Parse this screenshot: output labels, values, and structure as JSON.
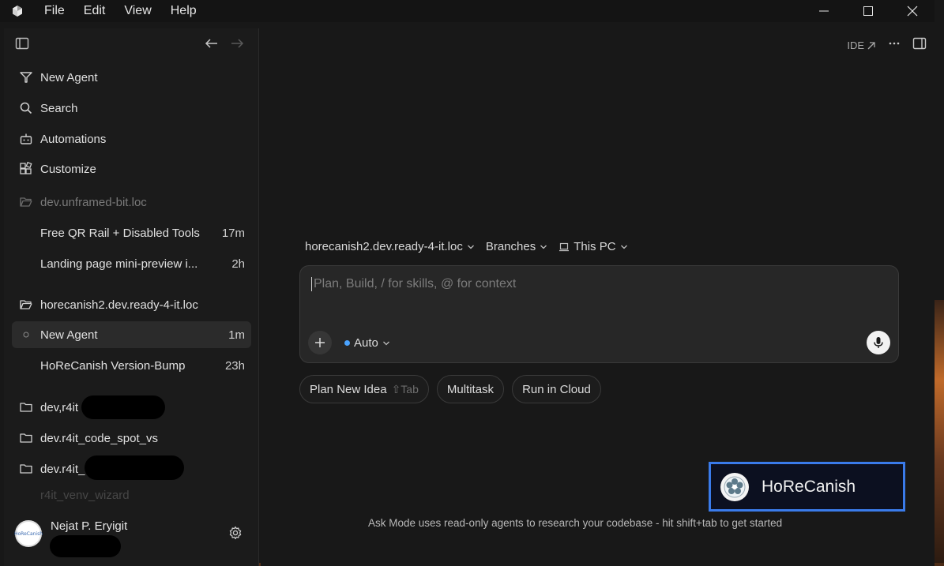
{
  "titlebar": {
    "menu": [
      "File",
      "Edit",
      "View",
      "Help"
    ]
  },
  "sidebar": {
    "nav": [
      {
        "label": "New Agent",
        "icon": "new-agent-icon"
      },
      {
        "label": "Search",
        "icon": "search-icon"
      },
      {
        "label": "Automations",
        "icon": "robot-icon"
      },
      {
        "label": "Customize",
        "icon": "blocks-icon"
      }
    ],
    "workspaces": [
      {
        "label": "dev.unframed-bit.loc",
        "icon": "folder-open-icon"
      },
      {
        "label": "horecanish2.dev.ready-4-it.loc",
        "icon": "folder-open-icon"
      },
      {
        "label": "dev,r4it",
        "icon": "folder-icon"
      },
      {
        "label": "dev.r4it_code_spot_vs",
        "icon": "folder-icon"
      },
      {
        "label": "dev.r4it_",
        "icon": "folder-icon"
      },
      {
        "label": "r4it_venv_wizard",
        "icon": "folder-icon"
      }
    ],
    "agents_unframed": [
      {
        "label": "Free QR Rail + Disabled Tools",
        "time": "17m"
      },
      {
        "label": "Landing page mini-preview i...",
        "time": "2h"
      }
    ],
    "agents_horecanish": [
      {
        "label": "New Agent",
        "time": "1m",
        "active": true
      },
      {
        "label": "HoReCanish Version-Bump",
        "time": "23h"
      }
    ],
    "user": {
      "name": "Nejat P. Eryigit",
      "avatar_text": "HoReCanish"
    }
  },
  "main": {
    "ide_label": "IDE",
    "selectors": {
      "workspace": "horecanish2.dev.ready-4-it.loc",
      "branches": "Branches",
      "machine": "This PC"
    },
    "composer": {
      "placeholder": "Plan, Build, / for skills, @ for context",
      "mode": "Auto"
    },
    "chips": [
      {
        "label": "Plan New Idea",
        "shortcut": "⇧Tab"
      },
      {
        "label": "Multitask"
      },
      {
        "label": "Run in Cloud"
      }
    ],
    "tip": "Ask Mode uses read-only agents to research your codebase - hit shift+tab to get started"
  },
  "overlay": {
    "name": "HoReCanish"
  },
  "colors": {
    "accent": "#3a7bea",
    "mode_dot": "#4aa3ff",
    "background": "#181818"
  }
}
